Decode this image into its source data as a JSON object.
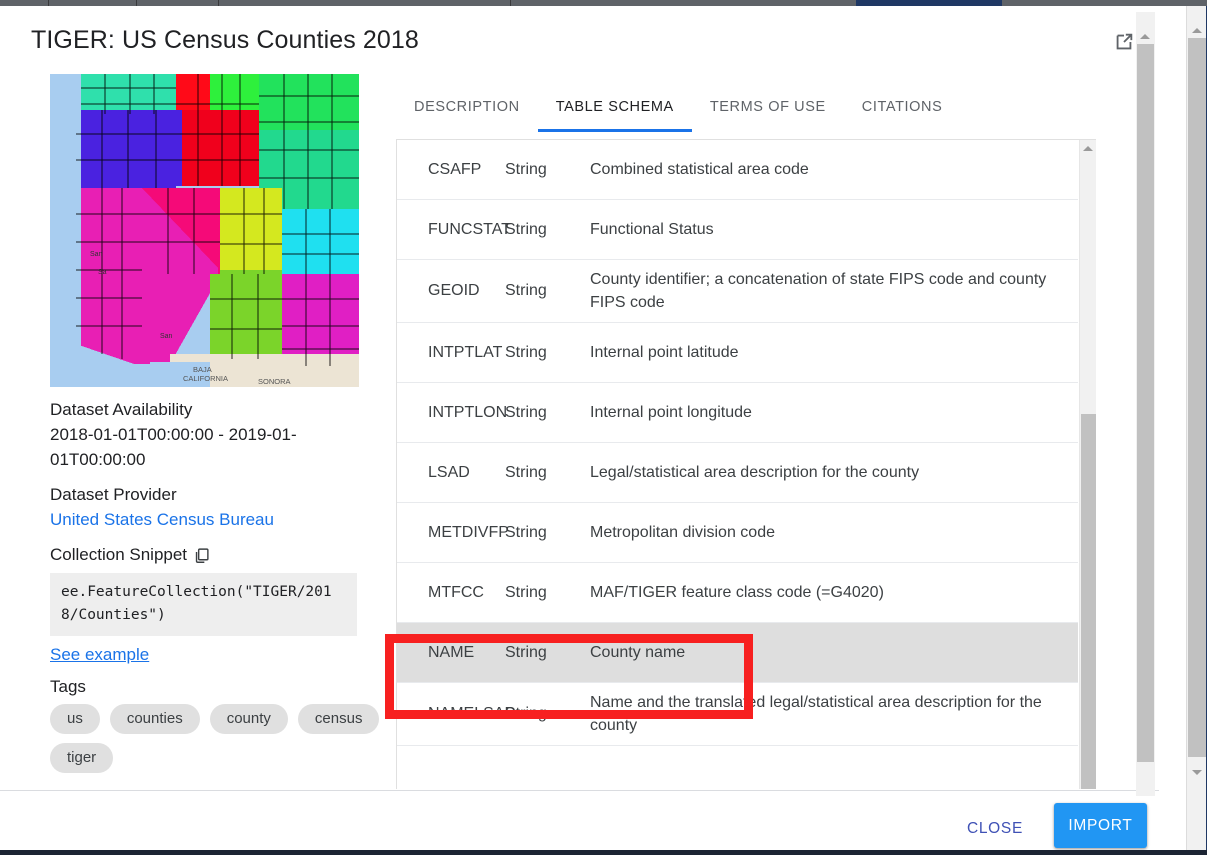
{
  "dialog": {
    "title": "TIGER: US Census Counties 2018",
    "open_in_new_icon": "open-in-new-icon"
  },
  "left_panel": {
    "thumbnail_alt": "map-thumbnail",
    "availability_label": "Dataset Availability",
    "availability_value": "2018-01-01T00:00:00 - 2019-01-01T00:00:00",
    "provider_label": "Dataset Provider",
    "provider_link": "United States Census Bureau",
    "snippet_label": "Collection Snippet",
    "copy_icon": "copy-icon",
    "snippet_code": "ee.FeatureCollection(\"TIGER/2018/Counties\")",
    "see_example_link": "See example",
    "tags_label": "Tags",
    "tags": [
      "us",
      "counties",
      "county",
      "census",
      "tiger"
    ]
  },
  "tabs": [
    {
      "label": "DESCRIPTION",
      "active": false
    },
    {
      "label": "TABLE SCHEMA",
      "active": true
    },
    {
      "label": "TERMS OF USE",
      "active": false
    },
    {
      "label": "CITATIONS",
      "active": false
    }
  ],
  "schema_table": {
    "rows": [
      {
        "name": "CSAFP",
        "type": "String",
        "description": "Combined statistical area code",
        "highlighted": false
      },
      {
        "name": "FUNCSTAT",
        "type": "String",
        "description": "Functional Status",
        "highlighted": false
      },
      {
        "name": "GEOID",
        "type": "String",
        "description": "County identifier; a concatenation of state FIPS code and county FIPS code",
        "highlighted": false
      },
      {
        "name": "INTPTLAT",
        "type": "String",
        "description": "Internal point latitude",
        "highlighted": false
      },
      {
        "name": "INTPTLON",
        "type": "String",
        "description": "Internal point longitude",
        "highlighted": false
      },
      {
        "name": "LSAD",
        "type": "String",
        "description": "Legal/statistical area description for the county",
        "highlighted": false
      },
      {
        "name": "METDIVFP",
        "type": "String",
        "description": "Metropolitan division code",
        "highlighted": false
      },
      {
        "name": "MTFCC",
        "type": "String",
        "description": "MAF/TIGER feature class code (=G4020)",
        "highlighted": false
      },
      {
        "name": "NAME",
        "type": "String",
        "description": "County name",
        "highlighted": true
      },
      {
        "name": "NAMELSAD",
        "type": "String",
        "description": "Name and the translated legal/statistical area description for the county",
        "highlighted": false
      }
    ]
  },
  "footer": {
    "close_label": "CLOSE",
    "import_label": "IMPORT"
  },
  "annotation": {
    "color": "#f72020",
    "target_row": "NAME"
  },
  "colors": {
    "accent_blue": "#1a73e8",
    "import_blue": "#2196f3",
    "close_indigo": "#3f51b5",
    "tag_gray": "#e0e0e0",
    "row_highlight": "#dedede",
    "annotation_red": "#f72020"
  }
}
